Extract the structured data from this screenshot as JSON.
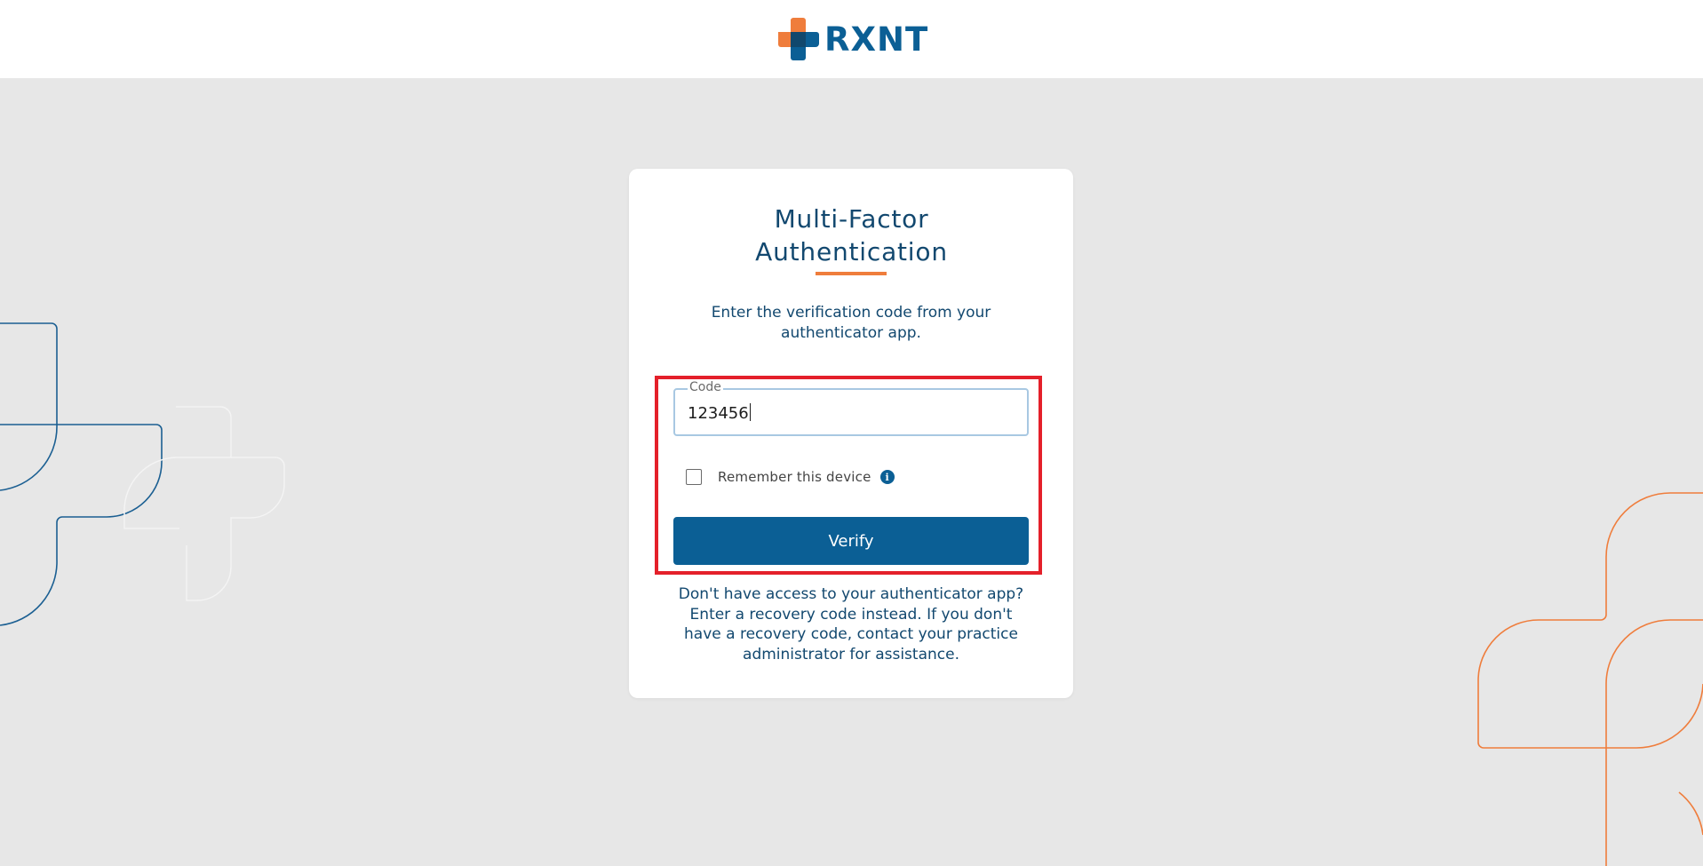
{
  "brand": {
    "logo_text": "RXNT",
    "colors": {
      "primary": "#0b5f95",
      "accent": "#ef7d3c",
      "title": "#12486f"
    }
  },
  "card": {
    "title_line1": "Multi-Factor",
    "title_line2": "Authentication",
    "instruction": "Enter the verification code from your authenticator app.",
    "code_label": "Code",
    "code_value": "123456",
    "remember_label": "Remember this device",
    "remember_checked": false,
    "info_glyph": "i",
    "verify_label": "Verify",
    "help_text": "Don't have access to your authenticator app? Enter a recovery code instead. If you don't have a recovery code, contact your practice administrator for assistance."
  },
  "icons": {
    "logo_mark": "rxnt-cross-logo-icon",
    "info": "info-icon",
    "decor_left": "cross-outline-decoration",
    "decor_right": "cross-outline-decoration"
  }
}
